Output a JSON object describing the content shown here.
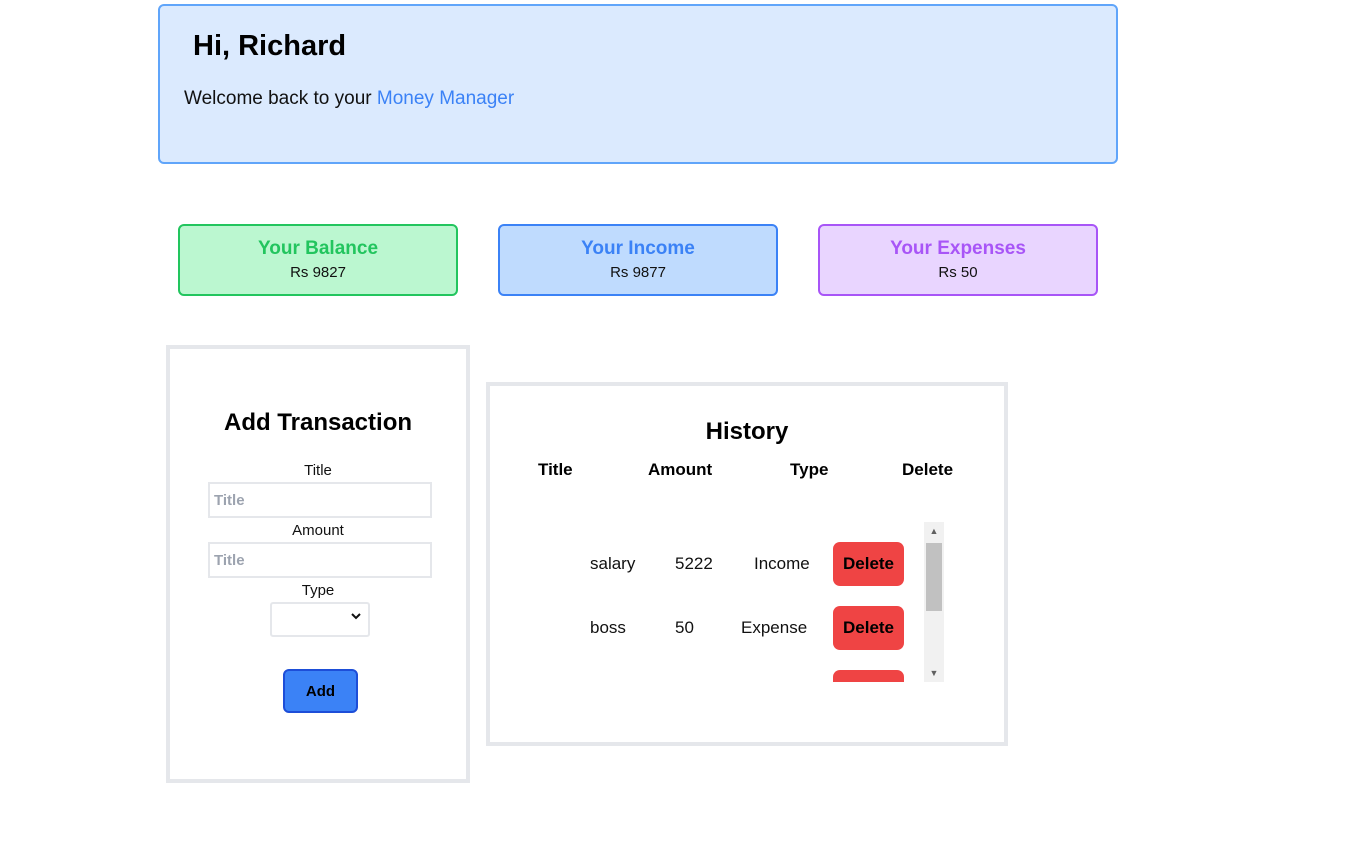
{
  "greeting": {
    "title": "Hi, Richard",
    "welcome_text": "Welcome back to your ",
    "brand_name": "Money Manager"
  },
  "summary": {
    "balance": {
      "label": "Your Balance",
      "value": "Rs 9827",
      "color": "#22c55e"
    },
    "income": {
      "label": "Your Income",
      "value": "Rs 9877",
      "color": "#3b82f6"
    },
    "expenses": {
      "label": "Your Expenses",
      "value": "Rs 50",
      "color": "#a855f7"
    }
  },
  "add_transaction": {
    "heading": "Add Transaction",
    "title_label": "Title",
    "title_placeholder": "Title",
    "amount_label": "Amount",
    "amount_placeholder": "Title",
    "type_label": "Type",
    "type_selected": "",
    "add_button": "Add"
  },
  "history": {
    "heading": "History",
    "columns": [
      "Title",
      "Amount",
      "Type",
      "Delete"
    ],
    "delete_label": "Delete",
    "rows": [
      {
        "title": "salary",
        "amount": "5222",
        "type": "Income"
      },
      {
        "title": "boss",
        "amount": "50",
        "type": "Expense"
      },
      {
        "title": "",
        "amount": "",
        "type": ""
      }
    ]
  },
  "icons": {
    "select_chevron": "chevron-down-icon",
    "scroll_up": "scroll-up-arrow-icon",
    "scroll_down": "scroll-down-arrow-icon"
  }
}
